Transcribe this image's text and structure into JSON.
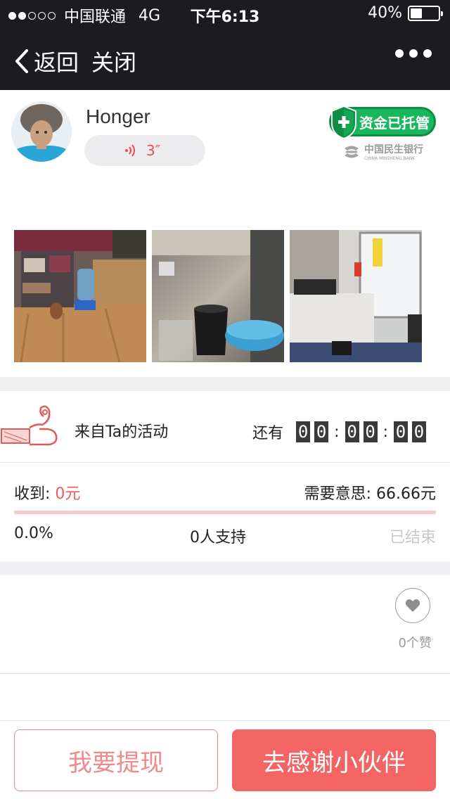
{
  "status_bar": {
    "carrier": "中国联通",
    "network": "4G",
    "time": "下午6:13",
    "battery": "40%"
  },
  "nav": {
    "back_label": "返回",
    "close_label": "关闭"
  },
  "profile": {
    "username": "Honger",
    "voice_duration": "3″",
    "escrow_badge": "资金已托管",
    "bank_name": "中国民生银行",
    "bank_name_en": "CHINA MINSHENG BANK"
  },
  "activity": {
    "label": "来自Ta的活动",
    "countdown_prefix": "还有",
    "countdown": [
      "0",
      "0",
      "0",
      "0",
      "0",
      "0"
    ]
  },
  "funding": {
    "received_label": "收到: ",
    "received_amount": "0元",
    "needed_label": "需要意思: 66.66元",
    "progress_percent": "0.0%",
    "progress_value": 0.0,
    "supporters": "0人支持",
    "status": "已结束"
  },
  "likes": {
    "count_label": "0个赞"
  },
  "actions": {
    "withdraw_label": "我要提现",
    "thank_label": "去感谢小伙伴"
  },
  "colors": {
    "accent": "#f36464",
    "escrow_green": "#18b75d",
    "topbar": "#1c1c20"
  }
}
